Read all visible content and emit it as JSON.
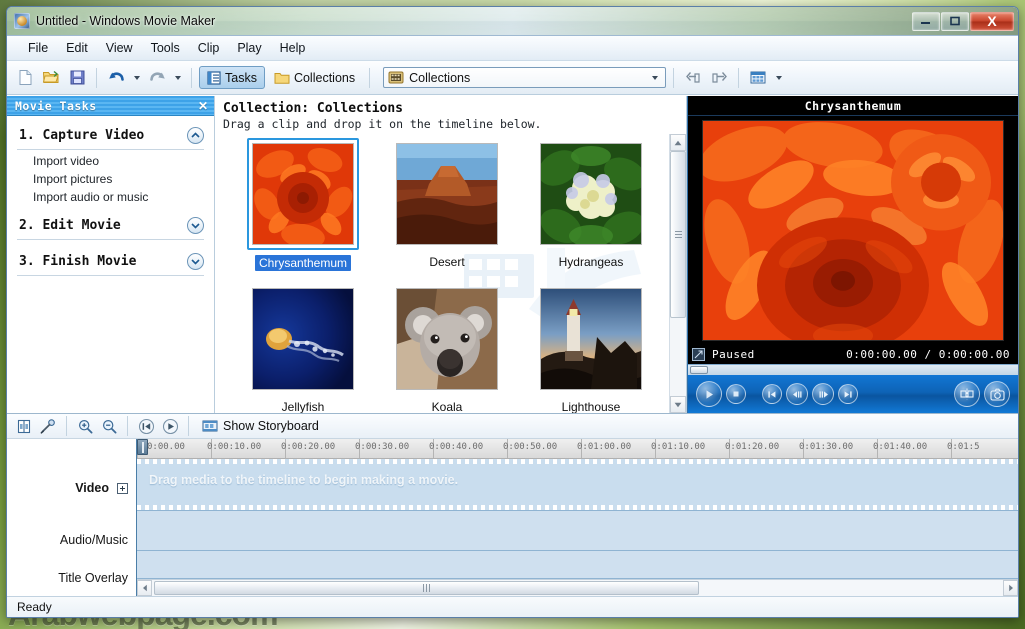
{
  "window": {
    "title": "Untitled - Windows Movie Maker",
    "app_icon": "movie-maker-icon",
    "minimize_label": "Minimize",
    "maximize_label": "Maximize",
    "close_label": "X"
  },
  "menubar": {
    "items": [
      {
        "label": "File"
      },
      {
        "label": "Edit"
      },
      {
        "label": "View"
      },
      {
        "label": "Tools"
      },
      {
        "label": "Clip"
      },
      {
        "label": "Play"
      },
      {
        "label": "Help"
      }
    ]
  },
  "toolbar": {
    "new_label": "New Project",
    "open_label": "Open Project",
    "save_label": "Save Project",
    "undo_label": "Undo",
    "redo_label": "Redo",
    "tasks_label": "Tasks",
    "collections_label": "Collections",
    "combo_value": "Collections",
    "combo_icon": "collections-folder-icon",
    "view_label": "Views"
  },
  "tasks_pane": {
    "header_title": "Movie Tasks",
    "close_label": "✕",
    "groups": [
      {
        "title": "1. Capture Video",
        "expanded": true,
        "links": [
          {
            "label": "Import video"
          },
          {
            "label": "Import pictures"
          },
          {
            "label": "Import audio or music"
          }
        ]
      },
      {
        "title": "2. Edit Movie",
        "expanded": false,
        "links": []
      },
      {
        "title": "3. Finish Movie",
        "expanded": false,
        "links": []
      }
    ]
  },
  "collections": {
    "title": "Collection: Collections",
    "subtitle": "Drag a clip and drop it on the timeline below.",
    "clips": [
      {
        "label": "Chrysanthemum",
        "selected": true
      },
      {
        "label": "Desert",
        "selected": false
      },
      {
        "label": "Hydrangeas",
        "selected": false
      },
      {
        "label": "Jellyfish",
        "selected": false
      },
      {
        "label": "Koala",
        "selected": false
      },
      {
        "label": "Lighthouse",
        "selected": false
      }
    ]
  },
  "monitor": {
    "title": "Chrysanthemum",
    "status_text": "Paused",
    "status_icon": "fullscreen-icon",
    "current_time": "0:00:00.00",
    "total_time": "0:00:00.00",
    "time_display": "0:00:00.00 / 0:00:00.00",
    "buttons": {
      "play": "play-button",
      "stop": "stop-button",
      "previous_frame": "previous-frame-button",
      "back": "step-back-button",
      "forward": "step-forward-button",
      "next_frame": "next-frame-button",
      "split": "split-clip-button",
      "snapshot": "take-picture-button"
    }
  },
  "timeline": {
    "toolbar": {
      "set_start_label": "Set Start Trim Point",
      "narrate_label": "Narrate Timeline",
      "zoom_in_label": "Zoom In",
      "zoom_out_label": "Zoom Out",
      "rewind_label": "Rewind Timeline",
      "play_label": "Play Timeline",
      "storyboard_label": "Show Storyboard"
    },
    "tracks": [
      {
        "label": "Video",
        "expandable": true
      },
      {
        "label": "Audio/Music",
        "expandable": false
      },
      {
        "label": "Title Overlay",
        "expandable": false
      }
    ],
    "drag_hint": "Drag media to the timeline to begin making a movie.",
    "ruler_ticks": [
      "0:00.00",
      "0:00:10.00",
      "0:00:20.00",
      "0:00:30.00",
      "0:00:40.00",
      "0:00:50.00",
      "0:01:00.00",
      "0:01:10.00",
      "0:01:20.00",
      "0:01:30.00",
      "0:01:40.00",
      "0:01:5"
    ]
  },
  "statusbar": {
    "text": "Ready"
  },
  "desktop": {
    "watermark": "Arabwebpage.com"
  },
  "colors": {
    "accent_blue": "#1176d4",
    "panel_header_blue": "#3da2e8",
    "selection_blue": "#2a74d8",
    "close_red": "#c8442b",
    "track_blue": "#cfe0ef"
  }
}
